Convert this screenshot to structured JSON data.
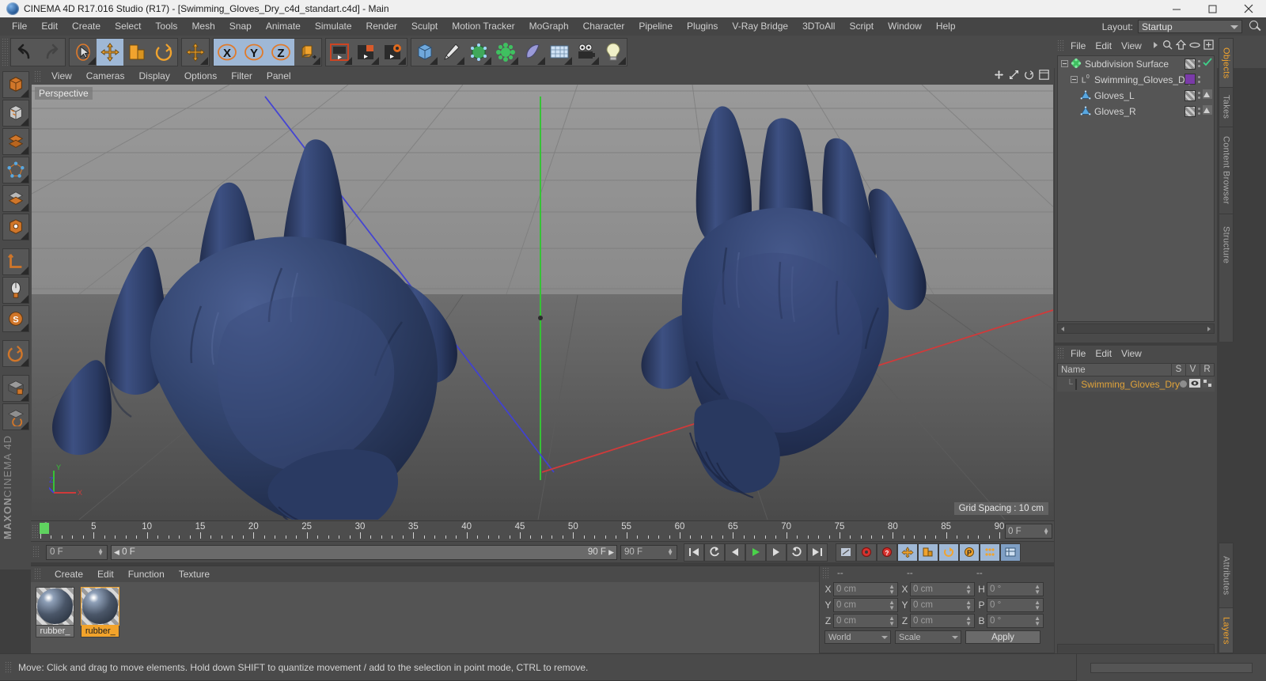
{
  "window": {
    "title": "CINEMA 4D R17.016 Studio (R17) - [Swimming_Gloves_Dry_c4d_standart.c4d] - Main",
    "minimize": "minimize-icon",
    "maximize": "maximize-icon",
    "close": "close-icon"
  },
  "menubar": {
    "items": [
      "File",
      "Edit",
      "Create",
      "Select",
      "Tools",
      "Mesh",
      "Snap",
      "Animate",
      "Simulate",
      "Render",
      "Sculpt",
      "Motion Tracker",
      "MoGraph",
      "Character",
      "Pipeline",
      "Plugins",
      "V-Ray Bridge",
      "3DToAll",
      "Script",
      "Window",
      "Help"
    ],
    "layout_label": "Layout:",
    "layout_value": "Startup",
    "search_icon": "search-icon"
  },
  "toolbar": {
    "groups": [
      {
        "name": "history",
        "buttons": [
          {
            "icon": "undo-icon",
            "label": "Undo",
            "active": false
          },
          {
            "icon": "redo-icon",
            "label": "Redo",
            "active": false
          }
        ]
      },
      {
        "name": "tools",
        "buttons": [
          {
            "icon": "live-selection-icon",
            "label": "Live Selection",
            "active": false
          },
          {
            "icon": "move-icon",
            "label": "Move",
            "active": true
          },
          {
            "icon": "scale-icon",
            "label": "Scale",
            "active": false
          },
          {
            "icon": "rotate-icon",
            "label": "Rotate",
            "active": false
          }
        ]
      },
      {
        "name": "lasttool",
        "buttons": [
          {
            "icon": "move-icon",
            "label": "Move Tool",
            "active": false
          }
        ]
      },
      {
        "name": "axislock",
        "buttons": [
          {
            "icon": "x-axis-icon",
            "label": "X",
            "active": true
          },
          {
            "icon": "y-axis-icon",
            "label": "Y",
            "active": true
          },
          {
            "icon": "z-axis-icon",
            "label": "Z",
            "active": true
          },
          {
            "icon": "world-coordinate-icon",
            "label": "World/Object Coordinate System",
            "active": false
          }
        ]
      },
      {
        "name": "render",
        "buttons": [
          {
            "icon": "render-view-icon",
            "label": "Render View",
            "active": false
          },
          {
            "icon": "render-region-icon",
            "label": "Render to Picture Viewer",
            "active": false
          },
          {
            "icon": "render-settings-icon",
            "label": "Edit Render Settings",
            "active": false
          }
        ]
      },
      {
        "name": "create",
        "buttons": [
          {
            "icon": "cube-primitive-icon",
            "label": "Add Cube Object",
            "active": false
          },
          {
            "icon": "spline-pen-icon",
            "label": "Add Spline",
            "active": false
          },
          {
            "icon": "generator-icon",
            "label": "Add Subdivision Surface",
            "active": false
          },
          {
            "icon": "deformer-icon",
            "label": "Add Bend Object",
            "active": false
          },
          {
            "icon": "environment-icon",
            "label": "Add Floor Object",
            "active": false
          },
          {
            "icon": "camera-icon",
            "label": "Add Camera",
            "active": false
          },
          {
            "icon": "light-icon",
            "label": "Add Light",
            "active": false
          }
        ]
      }
    ]
  },
  "left_palette": {
    "buttons": [
      {
        "icon": "model-mode-icon",
        "label": "Model Mode"
      },
      {
        "icon": "texture-mode-icon",
        "label": "Texture Mode"
      },
      {
        "icon": "polygon-mode-icon",
        "label": "Polygon Mode"
      },
      {
        "icon": "point-mode-icon",
        "label": "Point Mode"
      },
      {
        "icon": "edge-mode-icon",
        "label": "Edge Mode"
      },
      {
        "icon": "object-axis-mode-icon",
        "label": "Enable Axis Modification"
      },
      {
        "icon": "workplane-icon",
        "label": "Workplane"
      },
      {
        "icon": "viewport-lock-icon",
        "label": "Lock Workplane"
      },
      {
        "icon": "snap-icon",
        "label": "Enable Snapping"
      },
      {
        "icon": "quantize-icon",
        "label": "Quantizing"
      },
      {
        "icon": "lock-grid-icon",
        "label": "Lock Grid"
      },
      {
        "icon": "workplane-rotate-icon",
        "label": "Rotate Workplane"
      }
    ],
    "brand_line1": "MAXON",
    "brand_line2": "CINEMA 4D"
  },
  "viewport": {
    "menu": [
      "View",
      "Cameras",
      "Display",
      "Options",
      "Filter",
      "Panel"
    ],
    "label": "Perspective",
    "grid_spacing": "Grid Spacing : 10 cm",
    "nav_icons": [
      "move-camera-icon",
      "scale-camera-icon",
      "rotate-camera-icon",
      "maximize-viewport-icon"
    ],
    "axis_labels": {
      "x": "X",
      "y": "Y",
      "z": "Z"
    }
  },
  "timeline": {
    "labels": [
      "0",
      "5",
      "10",
      "15",
      "20",
      "25",
      "30",
      "35",
      "40",
      "45",
      "50",
      "55",
      "60",
      "65",
      "70",
      "75",
      "80",
      "85",
      "90"
    ],
    "values": [
      0,
      5,
      10,
      15,
      20,
      25,
      30,
      35,
      40,
      45,
      50,
      55,
      60,
      65,
      70,
      75,
      80,
      85,
      90
    ],
    "current_frame_field": "0 F",
    "playhead_frame": 0
  },
  "playbar": {
    "current_frame": "0 F",
    "range_start": "0 F",
    "range_end": "90 F",
    "max_frame": "90 F",
    "buttons": [
      {
        "icon": "go-to-start-icon",
        "label": "Go to Start"
      },
      {
        "icon": "step-back-keyframe-icon",
        "label": "Go to Previous Key"
      },
      {
        "icon": "step-back-frame-icon",
        "label": "Go to Previous Frame"
      },
      {
        "icon": "play-icon",
        "label": "Play Forwards"
      },
      {
        "icon": "step-forward-frame-icon",
        "label": "Go to Next Frame"
      },
      {
        "icon": "step-forward-keyframe-icon",
        "label": "Go to Next Key"
      },
      {
        "icon": "go-to-end-icon",
        "label": "Go to End"
      }
    ],
    "record_buttons": [
      {
        "icon": "autokeying-icon",
        "label": "Autokeying"
      },
      {
        "icon": "record-active-objects-icon",
        "label": "Record Active Objects"
      },
      {
        "icon": "keyframe-selection-icon",
        "label": "Keyframe Selection"
      },
      {
        "icon": "position-key-icon",
        "label": "Record Position"
      },
      {
        "icon": "scale-key-icon",
        "label": "Record Scale"
      },
      {
        "icon": "rotation-key-icon",
        "label": "Record Rotation"
      },
      {
        "icon": "parameter-key-icon",
        "label": "Record Parameter"
      },
      {
        "icon": "point-level-animation-icon",
        "label": "Point Level Animation"
      },
      {
        "icon": "timeline-icon",
        "label": "Open Timeline"
      }
    ]
  },
  "material_manager": {
    "menu": [
      "Create",
      "Edit",
      "Function",
      "Texture"
    ],
    "materials": [
      {
        "name": "rubber_",
        "selected": false
      },
      {
        "name": "rubber_",
        "selected": true
      }
    ]
  },
  "coordinates": {
    "headers": [
      "--",
      "--",
      "--"
    ],
    "rows": [
      {
        "axis1": "X",
        "value1": "0 cm",
        "axis2": "X",
        "value2": "0 cm",
        "axis3": "H",
        "value3": "0 °"
      },
      {
        "axis1": "Y",
        "value1": "0 cm",
        "axis2": "Y",
        "value2": "0 cm",
        "axis3": "P",
        "value3": "0 °"
      },
      {
        "axis1": "Z",
        "value1": "0 cm",
        "axis2": "Z",
        "value2": "0 cm",
        "axis3": "B",
        "value3": "0 °"
      }
    ],
    "coord_system": "World",
    "size_mode": "Scale",
    "apply_label": "Apply"
  },
  "object_manager": {
    "menu": [
      "File",
      "Edit",
      "View"
    ],
    "icons": [
      "chevron-right-icon",
      "search-icon",
      "home-icon",
      "ellipse-icon",
      "plus-box-icon"
    ],
    "tree": [
      {
        "name": "Subdivision Surface",
        "depth": 0,
        "icon": "subdivision-surface-icon",
        "swatch": "diagonal",
        "check": true
      },
      {
        "name": "Swimming_Gloves_Dry",
        "depth": 1,
        "icon": "null-object-icon",
        "swatch": "purple",
        "check": false
      },
      {
        "name": "Gloves_L",
        "depth": 2,
        "icon": "polygon-object-icon",
        "swatch": "diagonal",
        "check": false
      },
      {
        "name": "Gloves_R",
        "depth": 2,
        "icon": "polygon-object-icon",
        "swatch": "diagonal",
        "check": false
      }
    ]
  },
  "layer_manager": {
    "menu": [
      "File",
      "Edit",
      "View"
    ],
    "columns": [
      "Name",
      "S",
      "V",
      "R"
    ],
    "rows": [
      {
        "name": "Swimming_Gloves_Dry",
        "color": "#7a3ba8"
      }
    ]
  },
  "right_tabs_top": [
    "Objects",
    "Takes",
    "Content Browser",
    "Structure"
  ],
  "right_tabs_bottom": [
    "Attributes",
    "Layers"
  ],
  "right_tabs_active": {
    "top": "Objects",
    "bottom": "Layers"
  },
  "statusbar": {
    "message": "Move: Click and drag to move elements. Hold down SHIFT to quantize movement / add to the selection in point mode, CTRL to remove."
  },
  "colors": {
    "accent": "#f0a32e",
    "glove": "#2e3f6b",
    "ground_top": "#8f8f8f",
    "ground_bottom": "#4e4e4e",
    "axis_x": "#d03a3a",
    "axis_y": "#3ac23a",
    "axis_z": "#4646c8",
    "panel": "#4a4a4a",
    "field": "#5a5a5a",
    "selected_layer": "#7a3ba8"
  }
}
